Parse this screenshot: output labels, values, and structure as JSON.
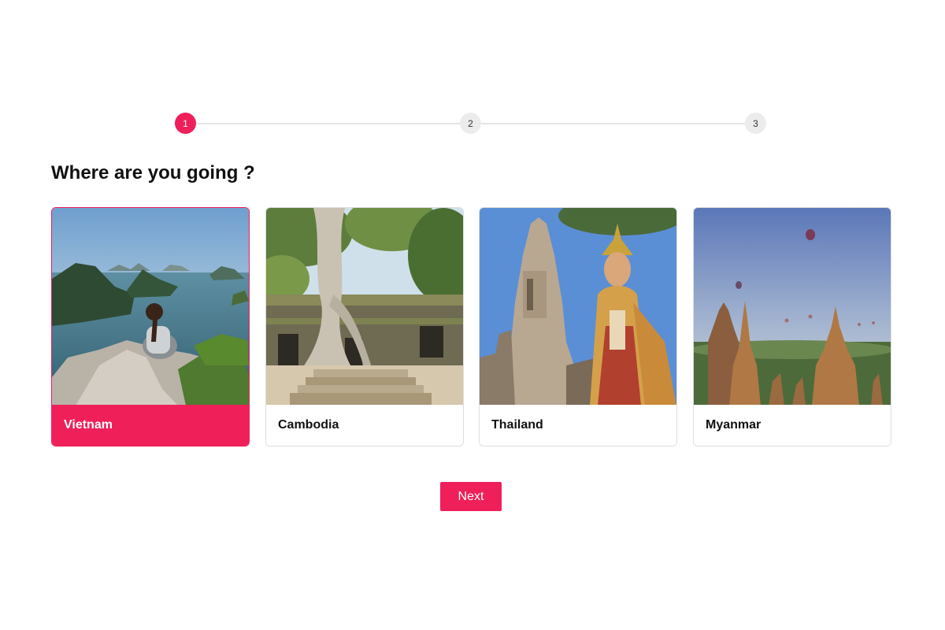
{
  "stepper": {
    "steps": [
      "1",
      "2",
      "3"
    ],
    "active_step": 1
  },
  "title": "Where are you going ?",
  "destinations": [
    {
      "label": "Vietnam",
      "selected": true,
      "image": "vietnam-halong-bay-image"
    },
    {
      "label": "Cambodia",
      "selected": false,
      "image": "cambodia-temple-ruins-image"
    },
    {
      "label": "Thailand",
      "selected": false,
      "image": "thailand-temple-dancer-image"
    },
    {
      "label": "Myanmar",
      "selected": false,
      "image": "myanmar-bagan-pagodas-image"
    }
  ],
  "next_button": "Next",
  "colors": {
    "accent": "#ef1f5a",
    "inactive_step": "#ececec",
    "line": "#e5e5e5"
  }
}
